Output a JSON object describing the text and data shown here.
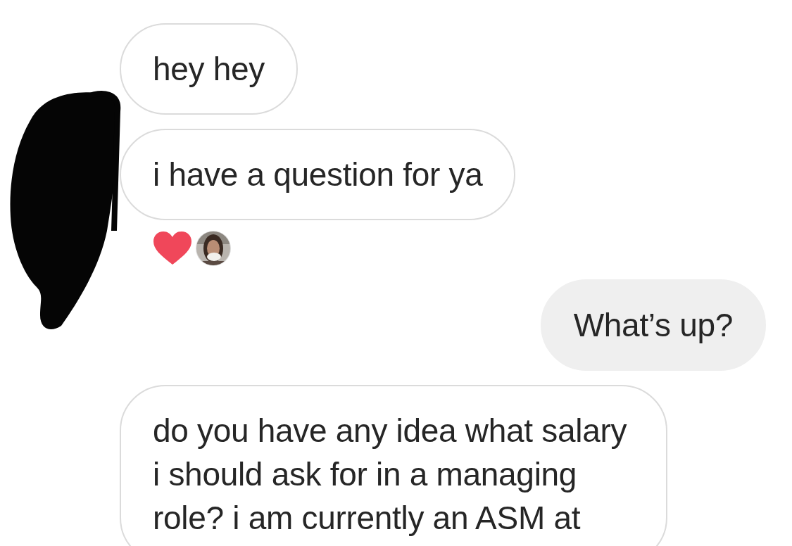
{
  "messages": [
    {
      "kind": "received",
      "text": "hey hey"
    },
    {
      "kind": "received",
      "text": "i have a question for ya",
      "reactions": [
        {
          "kind": "heart"
        }
      ]
    },
    {
      "kind": "sent",
      "text": "What’s up?"
    },
    {
      "kind": "received",
      "text": "do you have any idea what salary i should ask for in a managing role? i am currently an ASM at"
    }
  ]
}
